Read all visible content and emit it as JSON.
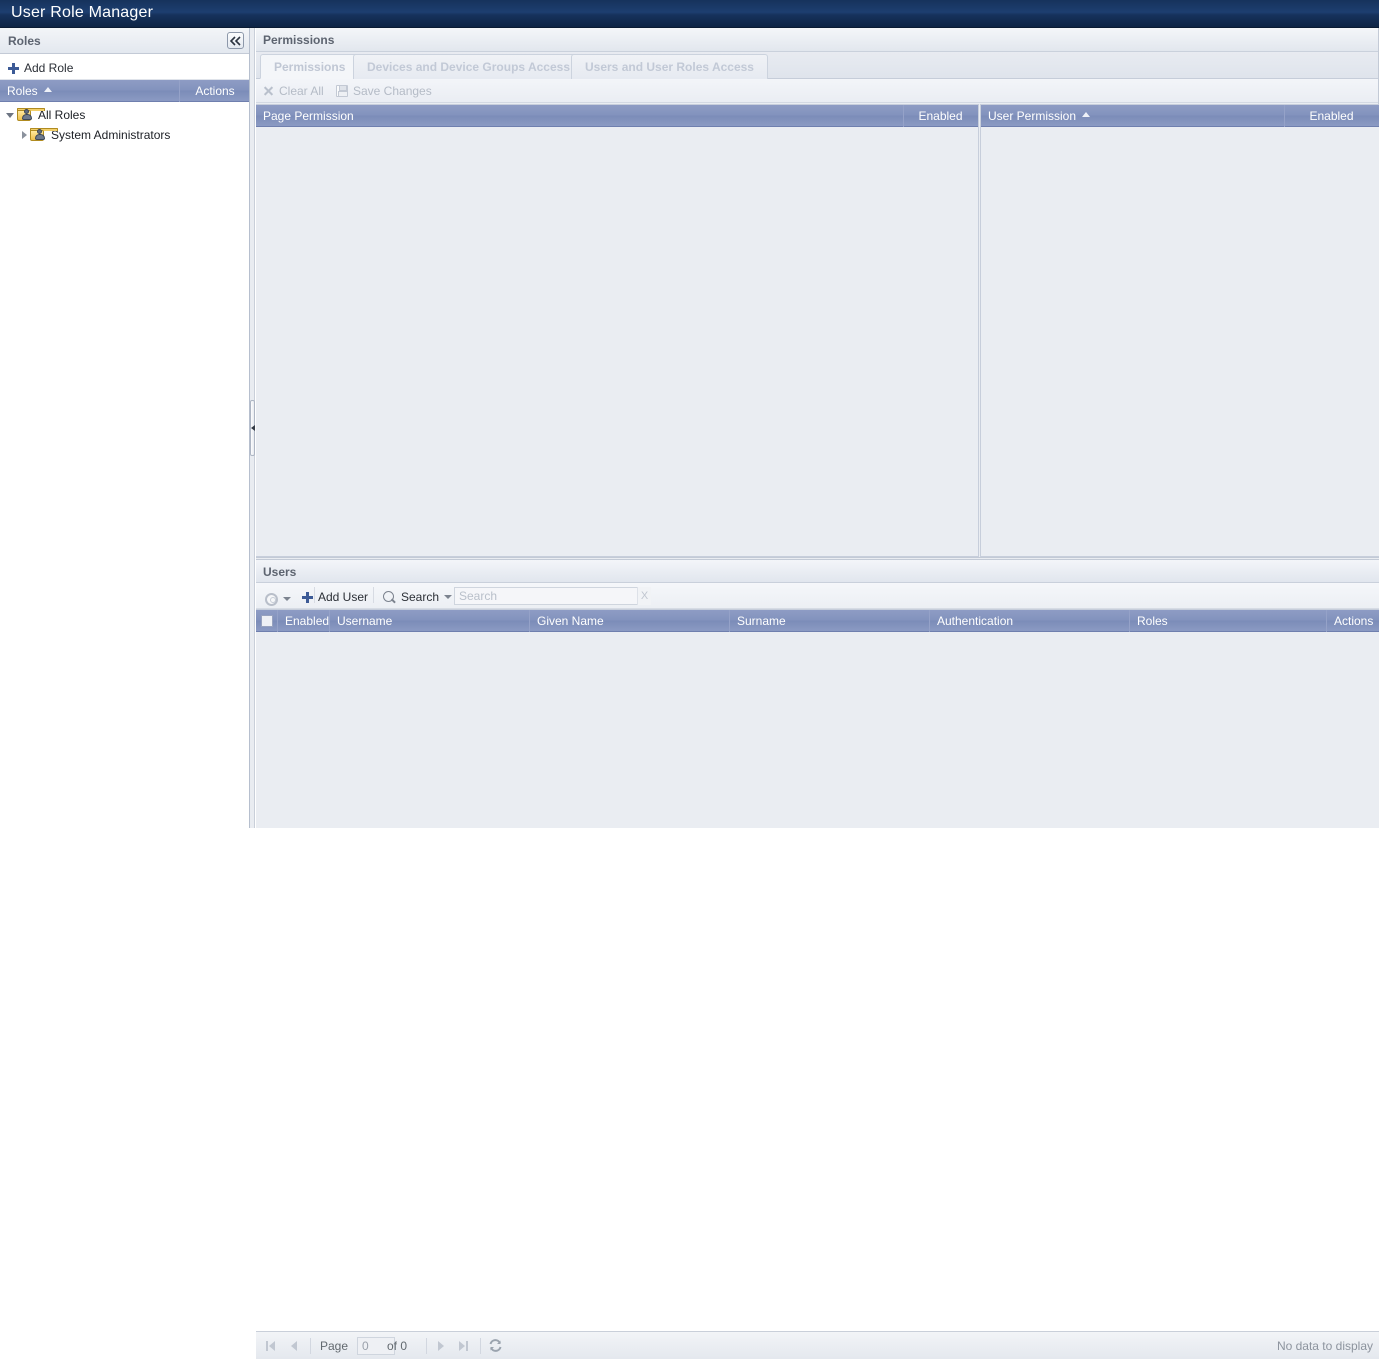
{
  "window": {
    "title": "User Role Manager"
  },
  "roles_panel": {
    "header_title": "Roles",
    "collapse_tooltip": "Collapse",
    "add_role_label": "Add Role",
    "grid_columns": [
      {
        "label": "Roles",
        "sorted": "asc"
      },
      {
        "label": "Actions"
      }
    ],
    "tree": [
      {
        "label": "All Roles",
        "expanded": true,
        "depth": 0
      },
      {
        "label": "System Administrators",
        "expanded": false,
        "depth": 1
      }
    ]
  },
  "permissions_panel": {
    "header_title": "Permissions",
    "tabs": [
      {
        "label": "Permissions",
        "active": true
      },
      {
        "label": "Devices and Device Groups Access",
        "active": false
      },
      {
        "label": "Users and User Roles Access",
        "active": false
      }
    ],
    "toolbar": {
      "clear_all_label": "Clear All",
      "save_changes_label": "Save Changes",
      "clear_all_icon": "x-icon",
      "save_changes_icon": "save-icon"
    },
    "left_grid_columns": [
      {
        "label": "Page Permission"
      },
      {
        "label": "Enabled"
      }
    ],
    "right_grid_columns": [
      {
        "label": "User Permission",
        "sorted": "asc"
      },
      {
        "label": "Enabled"
      }
    ],
    "left_grid_rows": [],
    "right_grid_rows": []
  },
  "users_panel": {
    "header_title": "Users",
    "toolbar": {
      "gear_icon": "gear-icon",
      "add_user_label": "Add User",
      "search_label": "Search",
      "search_placeholder": "Search",
      "search_value": "",
      "search_clear_label": "X"
    },
    "grid_columns": [
      {
        "label": ""
      },
      {
        "label": "Enabled"
      },
      {
        "label": "Username"
      },
      {
        "label": "Given Name"
      },
      {
        "label": "Surname"
      },
      {
        "label": "Authentication"
      },
      {
        "label": "Roles"
      },
      {
        "label": "Actions"
      }
    ],
    "rows": [],
    "pager": {
      "first_icon": "first-page-icon",
      "prev_icon": "previous-page-icon",
      "page_label": "Page",
      "page_value": "0",
      "of_label": "of 0",
      "next_icon": "next-page-icon",
      "last_icon": "last-page-icon",
      "refresh_icon": "refresh-icon",
      "status": "No data to display"
    }
  },
  "colors": {
    "titlebar": "#16325c",
    "grid_header": "#8292bd",
    "panel_bg": "#eaedf2",
    "accent_plus": "#3c5a96"
  }
}
